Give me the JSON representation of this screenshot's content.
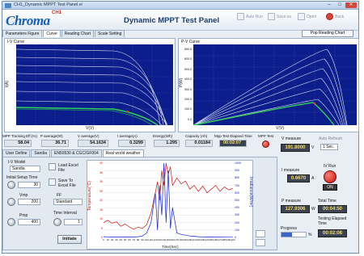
{
  "window": {
    "title": "CH1_Dynamic MPPT Test Panel.vi",
    "min_glyph": "–",
    "max_glyph": "□",
    "close_glyph": "✕"
  },
  "header": {
    "logo": "Chroma",
    "logo_ch": "CH1",
    "app_title": "Dynamic MPPT Test Panel",
    "toolbar": {
      "auto_run": "Auto Run",
      "save_as": "Save as",
      "open": "Open",
      "back": "Back"
    }
  },
  "tabs": [
    "Parameters Figure",
    "Curve",
    "Reading Chart",
    "Scale Setting"
  ],
  "pop_button": "Pop Reading Chart",
  "iv_plot": {
    "title": "I-V Curve",
    "ylabel": "I(A)",
    "xlabel": "V(V)"
  },
  "pv_plot": {
    "title": "P-V Curve",
    "ylabel": "P(W)",
    "xlabel": "V(V)",
    "y_ticks": [
      "650.0",
      "600.0",
      "500.0",
      "400.0",
      "300.0",
      "200.0",
      "100.0",
      "0.0"
    ]
  },
  "measurements": [
    {
      "label": "MPP Tracking Eff.(%)",
      "value": "58.04"
    },
    {
      "label": "P average(W)",
      "value": "36.71"
    },
    {
      "label": "V average(V)",
      "value": "54.1634"
    },
    {
      "label": "I average(A)",
      "value": "0.3299"
    },
    {
      "label": "Energy(Wh)",
      "value": "1.295"
    },
    {
      "label": "Capacity (Ah)",
      "value": "0.01184"
    },
    {
      "label": "Mpp Test Elapsed Time",
      "value": "00:02:07"
    },
    {
      "label": "MPP Test",
      "value": ""
    }
  ],
  "tabs2": [
    "User Define",
    "Sandia",
    "EN50530 & CGC/GF004",
    "Real world weather"
  ],
  "left_panel": {
    "iv_model_label": "I-V Model",
    "iv_model": "Sandia",
    "load_excel": "Load Excel File",
    "initial_setup_label": "Initial Setup Time",
    "initial_setup": "30",
    "save_excel": "Save To Excel File",
    "vmp_label": "Vmp",
    "vmp": "200",
    "ff_label": "FF",
    "ff": "Standard",
    "pmp_label": "Pmp",
    "pmp": "400",
    "time_interval_label": "Time Interval",
    "time_interval": "1",
    "initiate": "Initiate"
  },
  "weather_chart": {
    "y_left_label": "Temperature(°C)",
    "y_right_label": "Irradiance(W/m²)",
    "xlabel": "Time(Sec)",
    "x_ticks": [
      "0",
      "10",
      "20",
      "30",
      "40",
      "50",
      "60",
      "70",
      "80",
      "90",
      "100",
      "110",
      "120",
      "130",
      "140",
      "150",
      "160",
      "170",
      "180",
      "190",
      "200",
      "210",
      "220",
      "230",
      "240",
      "250",
      "260",
      "270",
      "280",
      "290",
      "300"
    ],
    "y_left_ticks": [
      "40",
      "35",
      "30",
      "25",
      "20",
      "15",
      "10",
      "5",
      "0"
    ],
    "y_right_ticks": [
      "1000",
      "900",
      "800",
      "700",
      "600",
      "500",
      "400",
      "300",
      "200",
      "100",
      "0"
    ]
  },
  "right_panel": {
    "v_measure_label": "V measure",
    "v_measure": "191.8000",
    "v_unit": "V",
    "auto_refresh_label": "Auto Refresh",
    "auto_refresh": "1 Sec.",
    "i_measure_label": "I measure",
    "i_measure": "0.6670",
    "i_unit": "A",
    "iv_run_label": "IV Run",
    "on": "ON",
    "p_measure_label": "P measure",
    "p_measure": "127.9306",
    "p_unit": "W",
    "total_time_label": "Total Time",
    "total_time": "00:04:50",
    "elapsed_label": "Testing Elapsed Time",
    "elapsed": "00:02:08",
    "progress_label": "Progress",
    "progress_unit": "%",
    "progress_fraction": 0.44
  },
  "chart_data": {
    "type": "line",
    "x": [
      0,
      10,
      20,
      30,
      40,
      50,
      60,
      70,
      80,
      90,
      100,
      110,
      120,
      125,
      130,
      135,
      140,
      145,
      150,
      155,
      160,
      170,
      180,
      190,
      200,
      210,
      220,
      230,
      240,
      250,
      260,
      270,
      280,
      290,
      300
    ],
    "series": [
      {
        "name": "",
        "color": "#d01010",
        "values": [
          200,
          230,
          190,
          210,
          150,
          180,
          140,
          110,
          140,
          120,
          170,
          330,
          600,
          750,
          500,
          900,
          700,
          1000,
          850,
          950,
          700,
          800,
          720,
          760,
          650,
          700,
          620,
          690,
          600,
          650,
          700,
          620,
          680,
          640,
          660
        ]
      },
      {
        "name": "",
        "color": "#1020d0",
        "values": [
          10,
          8,
          6,
          5,
          4,
          5,
          6,
          6,
          10,
          20,
          60,
          200,
          600,
          100,
          700,
          300,
          1000,
          200,
          900,
          120,
          400,
          60,
          40,
          30,
          20,
          15,
          10,
          8,
          6,
          5,
          4,
          4,
          3,
          3,
          2
        ]
      }
    ],
    "xlim": [
      0,
      300
    ],
    "ylim_right": [
      0,
      1000
    ]
  }
}
